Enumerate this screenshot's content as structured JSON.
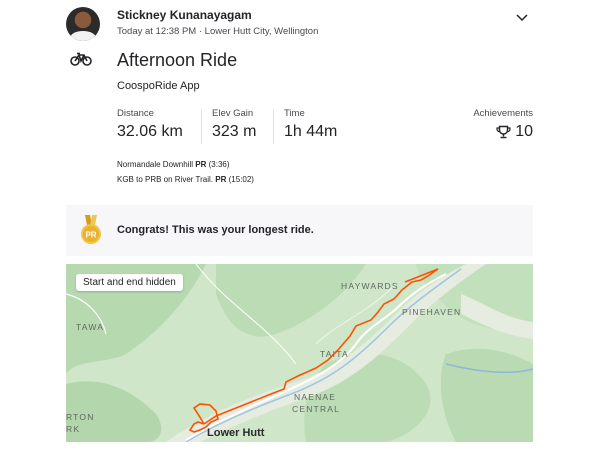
{
  "athlete": {
    "name": "Stickney Kunanayagam",
    "meta": "Today at 12:38 PM · Lower Hutt City, Wellington"
  },
  "activity": {
    "title": "Afternoon Ride",
    "device": "CoospoRide App",
    "sport_icon": "bicycle-icon"
  },
  "stats": {
    "distance": {
      "label": "Distance",
      "value": "32.06 km"
    },
    "elevation": {
      "label": "Elev Gain",
      "value": "323 m"
    },
    "time": {
      "label": "Time",
      "value": "1h 44m"
    },
    "achievements": {
      "label": "Achievements",
      "value": "10",
      "icon": "trophy-icon"
    }
  },
  "segments": [
    {
      "name": "Normandale Downhill",
      "badge": "PR",
      "time": "(3:36)"
    },
    {
      "name": "KGB to PRB on River Trail.",
      "badge": "PR",
      "time": "(15:02)"
    }
  ],
  "congrats": {
    "text": "Congrats! This was your longest ride.",
    "medal_label": "PR",
    "medal_color": "#e8b130"
  },
  "map": {
    "badge": "Start and end hidden",
    "route_color": "#fc5200",
    "places": {
      "haywards": "HAYWARDS",
      "pinehaven": "PINEHAVEN",
      "tawa": "TAWA",
      "taita": "TAITA",
      "naenae": "NAENAE",
      "central": "CENTRAL",
      "rton": "RTON",
      "rk": "RK",
      "lower_hutt": "Lower Hutt"
    }
  }
}
